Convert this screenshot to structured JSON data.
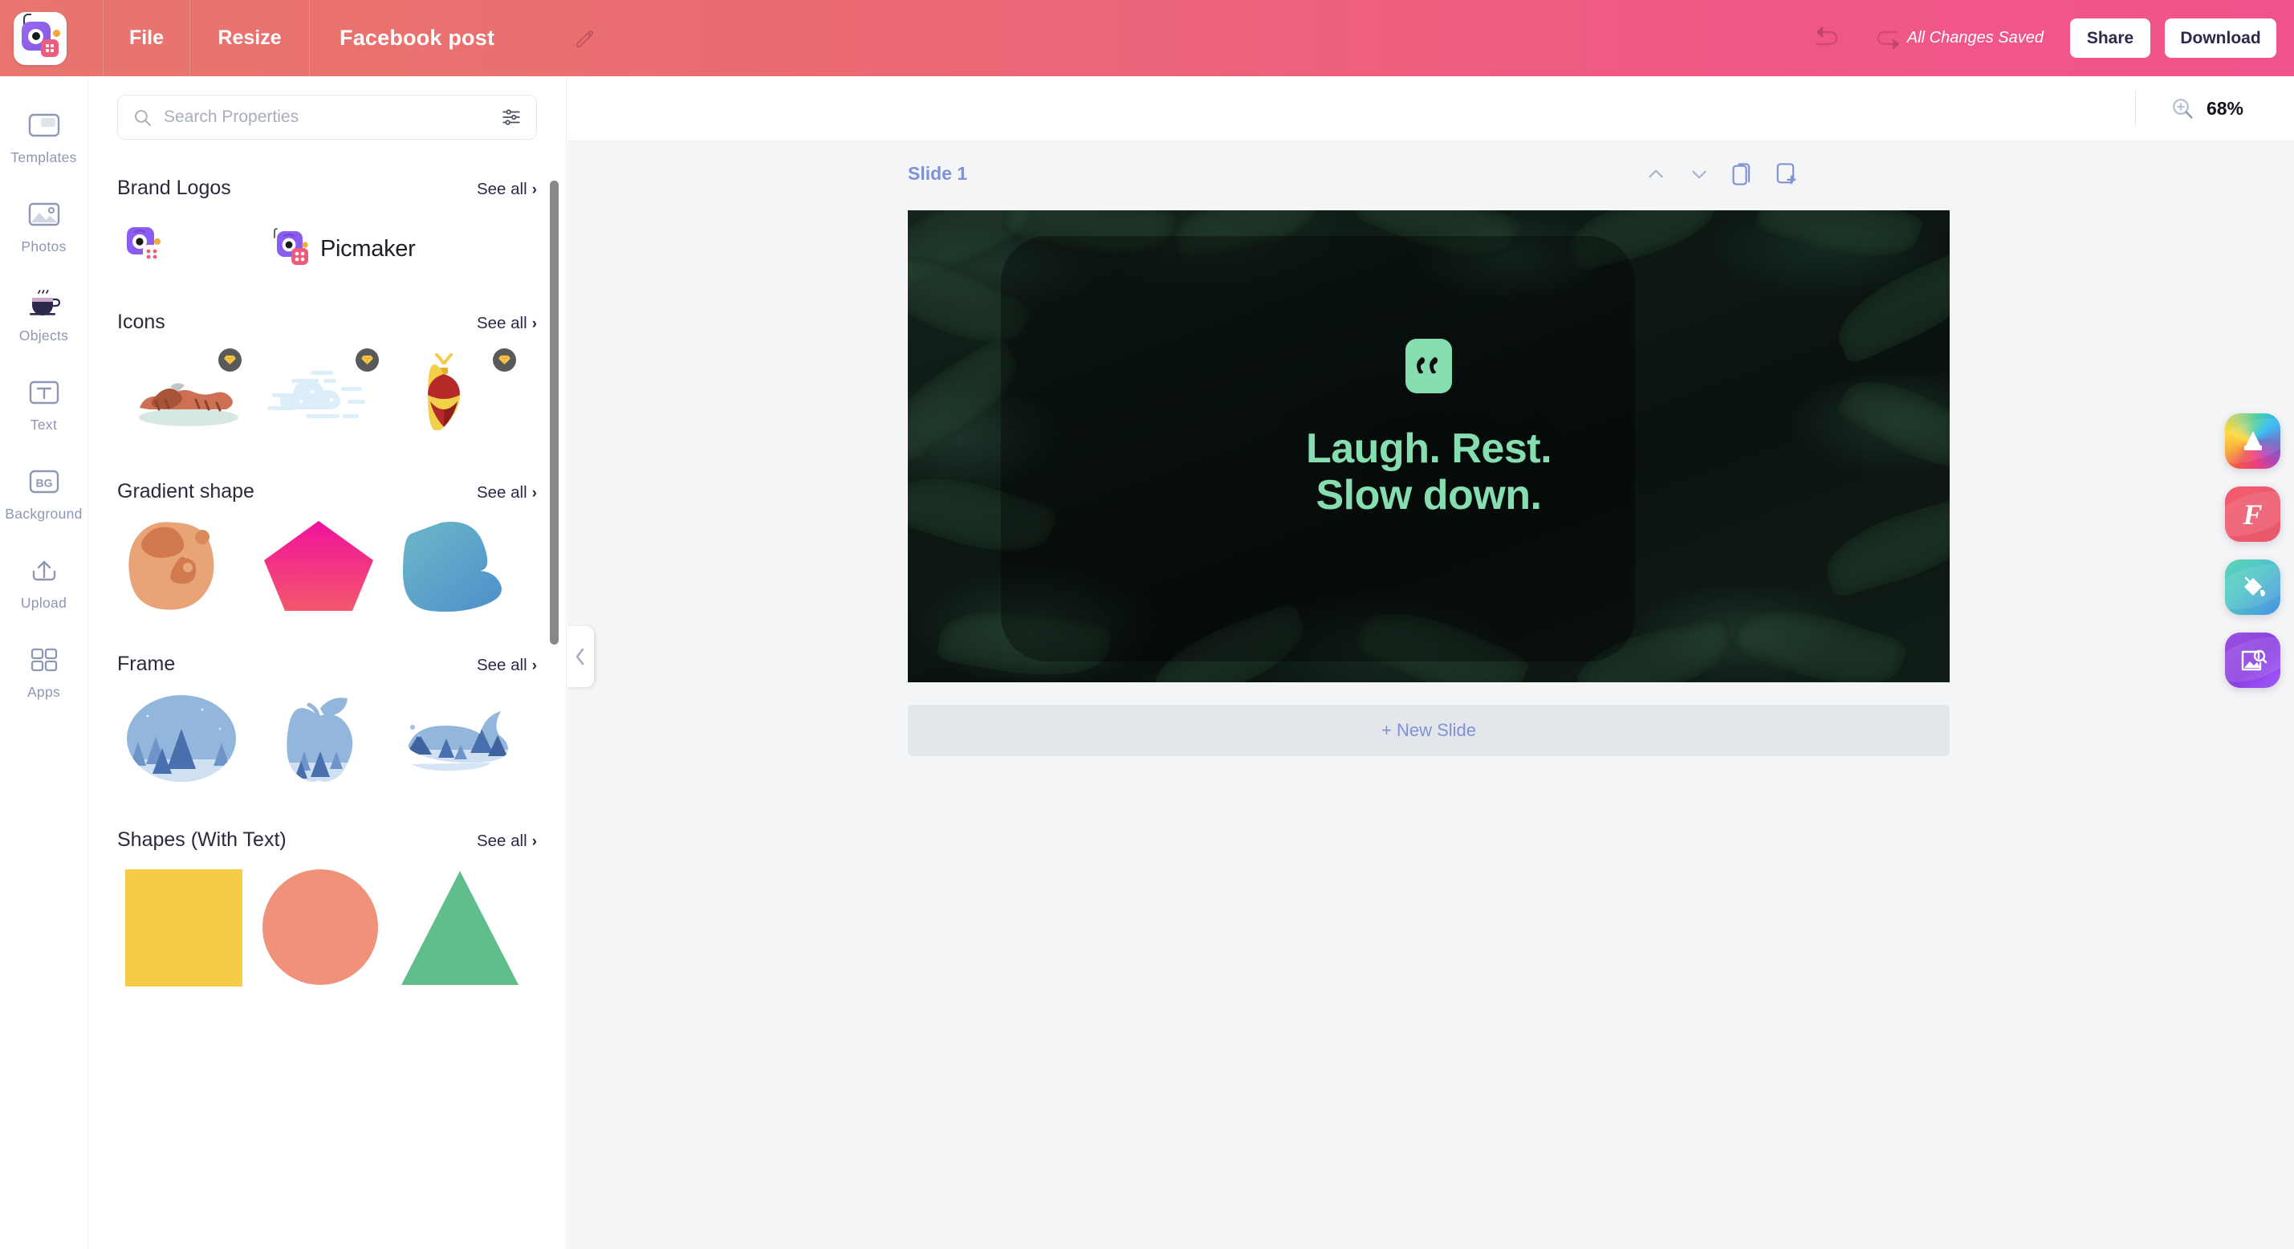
{
  "header": {
    "logo_name": "picmaker-logo",
    "menu": [
      {
        "label": "File",
        "name": "file-menu"
      },
      {
        "label": "Resize",
        "name": "resize-menu"
      }
    ],
    "document_title": "Facebook post",
    "rename_icon": "pencil-icon",
    "undo_icon": "undo-icon",
    "redo_icon": "redo-icon",
    "save_status": "All Changes Saved",
    "share_label": "Share",
    "download_label": "Download",
    "gradient_from": "#E8756F",
    "gradient_to": "#F0538C"
  },
  "rail": {
    "items": [
      {
        "label": "Templates",
        "icon": "templates-icon"
      },
      {
        "label": "Photos",
        "icon": "photos-icon"
      },
      {
        "label": "Objects",
        "icon": "coffee-cup-icon"
      },
      {
        "label": "Text",
        "icon": "text-t-icon"
      },
      {
        "label": "Background",
        "icon": "background-bg-icon"
      },
      {
        "label": "Upload",
        "icon": "upload-arrow-icon"
      },
      {
        "label": "Apps",
        "icon": "apps-grid-icon"
      }
    ],
    "active": "Objects"
  },
  "panel": {
    "search": {
      "placeholder": "Search Properties",
      "value": "",
      "icon": "search-icon",
      "filter_icon": "filter-sliders-icon"
    },
    "see_all_label": "See all",
    "sections": [
      {
        "title": "Brand Logos",
        "name": "brand-logos",
        "items": [
          {
            "name": "picmaker-mark",
            "type": "logo-mark"
          },
          {
            "name": "picmaker-wordmark",
            "type": "logo-wordmark",
            "text": "Picmaker"
          }
        ]
      },
      {
        "title": "Icons",
        "name": "icons",
        "items": [
          {
            "name": "grilled-food-icon",
            "premium": true
          },
          {
            "name": "cloud-icon",
            "premium": true
          },
          {
            "name": "ornament-icon",
            "premium": true
          }
        ]
      },
      {
        "title": "Gradient shape",
        "name": "gradient-shape",
        "items": [
          {
            "name": "blob-orange-shape",
            "color": "#E8A377"
          },
          {
            "name": "pentagon-pink-shape",
            "color": "#F0119C"
          },
          {
            "name": "blob-blue-shape",
            "color": "#5BA8C4"
          }
        ]
      },
      {
        "title": "Frame",
        "name": "frame",
        "items": [
          {
            "name": "circle-forest-frame"
          },
          {
            "name": "apple-forest-frame"
          },
          {
            "name": "whale-forest-frame"
          }
        ]
      },
      {
        "title": "Shapes (With Text)",
        "name": "shapes-with-text",
        "items": [
          {
            "name": "square-shape",
            "color": "#F6CB45"
          },
          {
            "name": "circle-shape",
            "color": "#F0917A"
          },
          {
            "name": "triangle-shape",
            "color": "#5FBE8C"
          }
        ]
      }
    ],
    "collapse_icon": "chevron-left-icon"
  },
  "workspace": {
    "zoom": {
      "icon": "zoom-in-icon",
      "value": "68%"
    },
    "slide": {
      "label": "Slide 1",
      "tools": [
        {
          "name": "move-up-icon",
          "glyph": "chevron-up"
        },
        {
          "name": "move-down-icon",
          "glyph": "chevron-down"
        },
        {
          "name": "duplicate-slide-icon",
          "glyph": "copy"
        },
        {
          "name": "add-slide-icon",
          "glyph": "plus-page"
        }
      ]
    },
    "canvas": {
      "name": "design-canvas",
      "quote_mark": "“",
      "accent_color": "#85DDB0",
      "lines": [
        "Laugh. Rest.",
        "Slow down."
      ]
    },
    "new_slide_label": "+ New Slide"
  },
  "float_tools": [
    {
      "name": "color-palette-tool",
      "icon": "rainbow-crown-icon"
    },
    {
      "name": "fonts-tool",
      "icon": "font-f-icon",
      "glyph": "F"
    },
    {
      "name": "fill-color-tool",
      "icon": "paint-bucket-icon"
    },
    {
      "name": "image-search-tool",
      "icon": "image-search-icon"
    }
  ]
}
